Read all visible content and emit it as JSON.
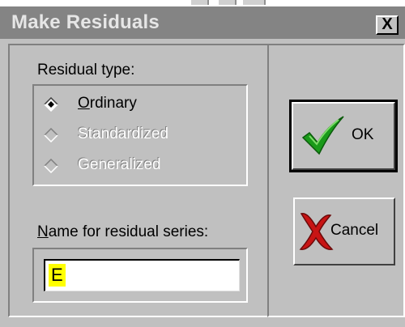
{
  "window": {
    "title": "Make Residuals",
    "close_label": "X"
  },
  "residual_type": {
    "group_label": "Residual type:",
    "options": [
      {
        "label": "Ordinary",
        "selected": true,
        "enabled": true
      },
      {
        "label": "Standardized",
        "selected": false,
        "enabled": false
      },
      {
        "label": "Generalized",
        "selected": false,
        "enabled": false
      }
    ]
  },
  "name_field": {
    "label": "Name for residual series:",
    "value": "E",
    "highlight_color": "#ffff00"
  },
  "buttons": {
    "ok_label": "OK",
    "cancel_label": "Cancel"
  },
  "colors": {
    "dialog_bg": "#c0c0c0",
    "titlebar_inactive": "#848484",
    "checkmark_green": "#1a9a1a",
    "cancel_x_red": "#c81414"
  },
  "icons": {
    "ok": "green-checkmark-icon",
    "cancel": "red-x-icon",
    "close": "close-icon"
  }
}
